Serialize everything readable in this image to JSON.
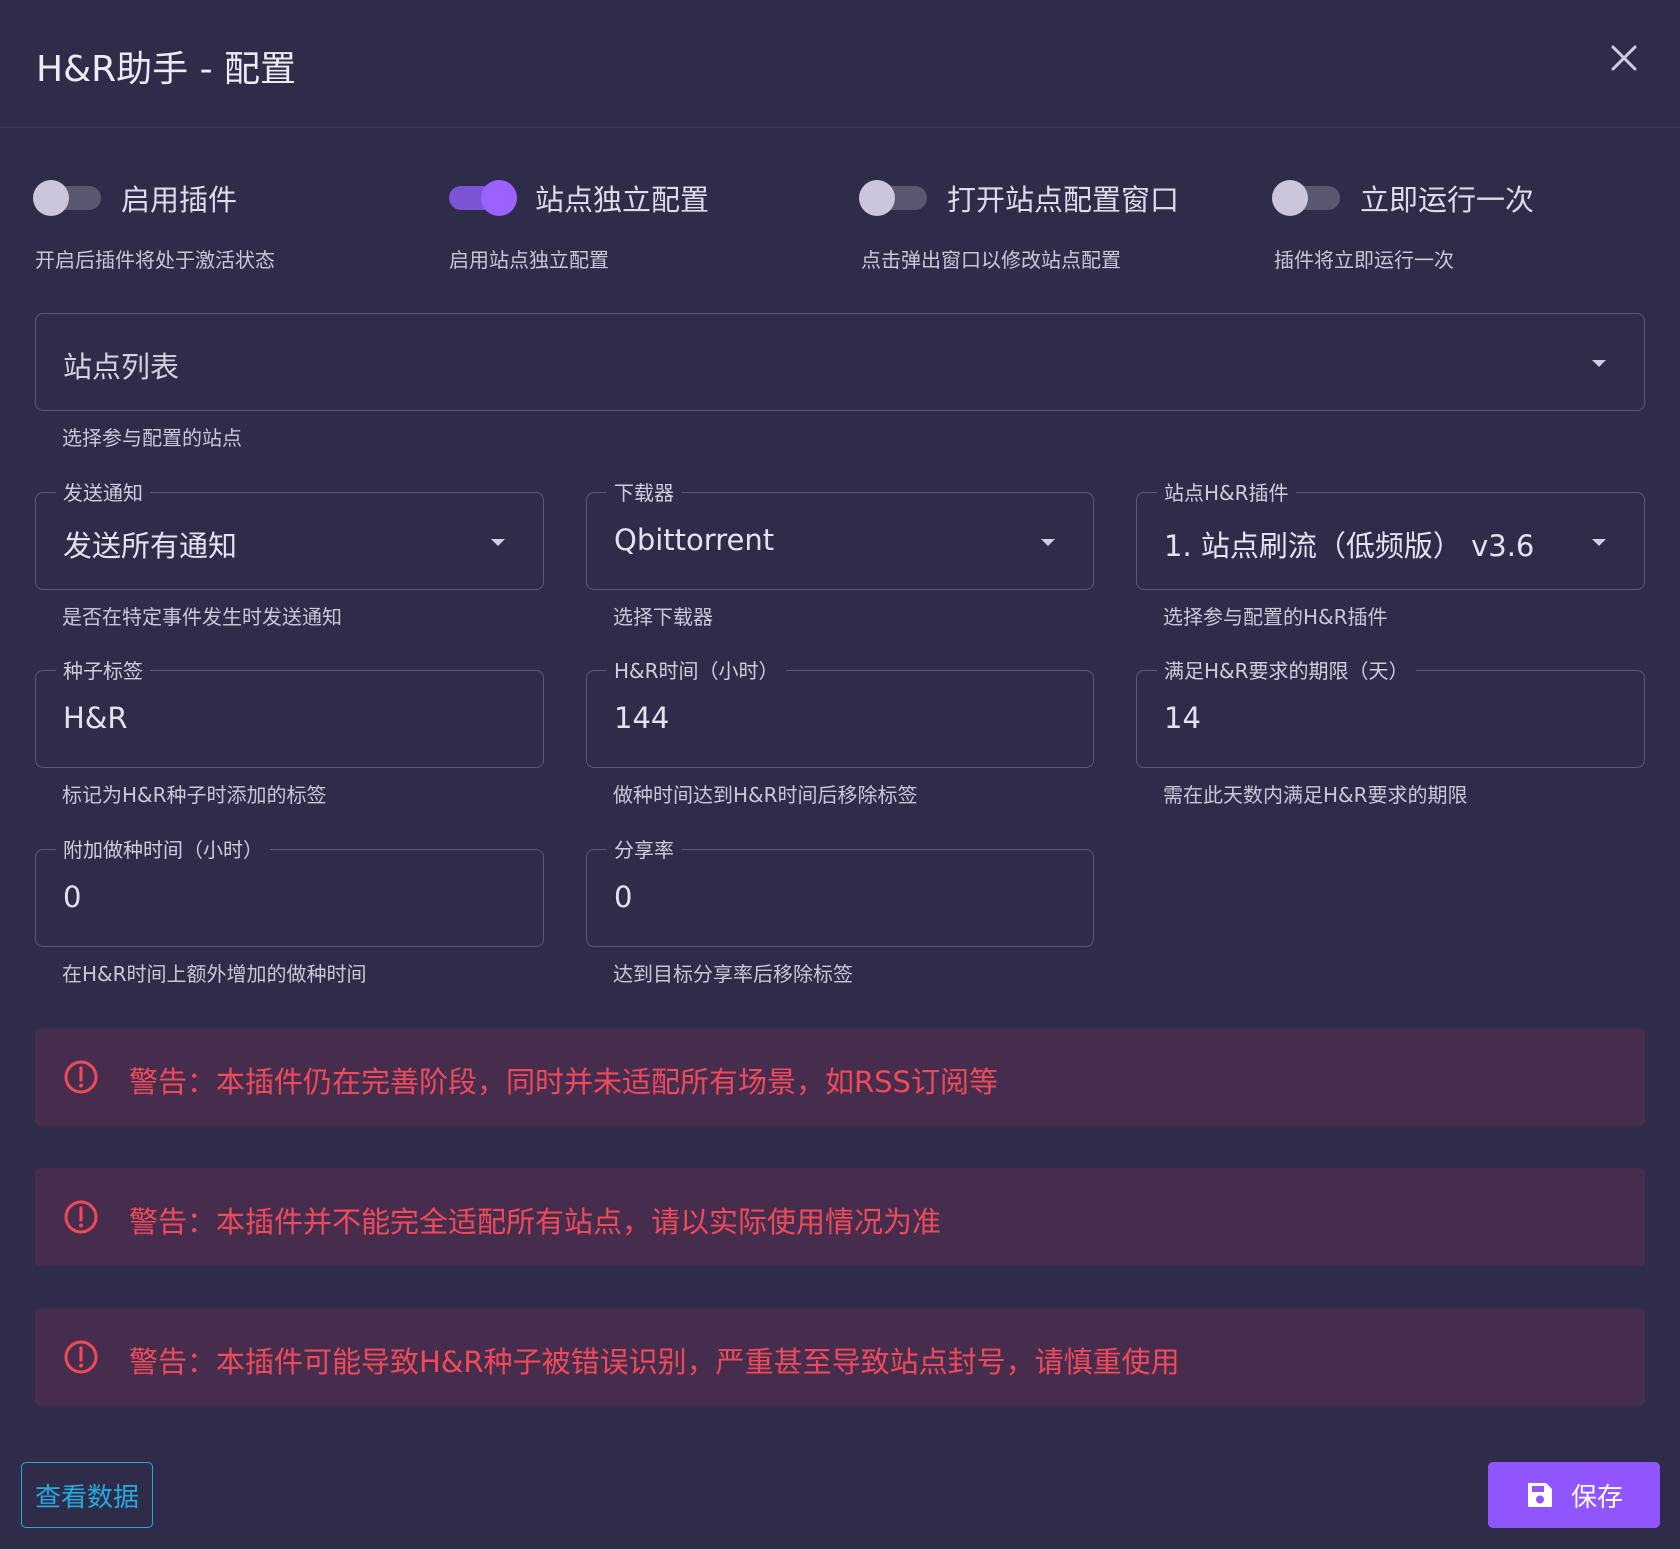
{
  "header": {
    "title": "H&R助手 - 配置",
    "close_icon": "close-icon"
  },
  "switches": [
    {
      "label": "启用插件",
      "hint": "开启后插件将处于激活状态",
      "checked": false
    },
    {
      "label": "站点独立配置",
      "hint": "启用站点独立配置",
      "checked": true
    },
    {
      "label": "打开站点配置窗口",
      "hint": "点击弹出窗口以修改站点配置",
      "checked": false
    },
    {
      "label": "立即运行一次",
      "hint": "插件将立即运行一次",
      "checked": false
    }
  ],
  "site_list": {
    "placeholder": "站点列表",
    "hint": "选择参与配置的站点"
  },
  "notify": {
    "legend": "发送通知",
    "value": "发送所有通知",
    "hint": "是否在特定事件发生时发送通知"
  },
  "downloader": {
    "legend": "下载器",
    "value": "Qbittorrent",
    "hint": "选择下载器"
  },
  "hr_plugin": {
    "legend": "站点H&R插件",
    "value": "1. 站点刷流（低频版） v3.6",
    "hint": "选择参与配置的H&R插件"
  },
  "torrent_tag": {
    "legend": "种子标签",
    "value": "H&R",
    "hint": "标记为H&R种子时添加的标签"
  },
  "hr_time": {
    "legend": "H&R时间（小时）",
    "value": "144",
    "hint": "做种时间达到H&R时间后移除标签"
  },
  "hr_deadline": {
    "legend": "满足H&R要求的期限（天）",
    "value": "14",
    "hint": "需在此天数内满足H&R要求的期限"
  },
  "extra_seed": {
    "legend": "附加做种时间（小时）",
    "value": "0",
    "hint": "在H&R时间上额外增加的做种时间"
  },
  "ratio": {
    "legend": "分享率",
    "value": "0",
    "hint": "达到目标分享率后移除标签"
  },
  "alerts": [
    {
      "text": "警告：本插件仍在完善阶段，同时并未适配所有场景，如RSS订阅等",
      "icon": "alert-circle-icon"
    },
    {
      "text": "警告：本插件并不能完全适配所有站点，请以实际使用情况为准",
      "icon": "alert-circle-icon"
    },
    {
      "text": "警告：本插件可能导致H&R种子被错误识别，严重甚至导致站点封号，请慎重使用",
      "icon": "alert-circle-icon"
    }
  ],
  "footer": {
    "view_label": "查看数据",
    "save_label": "保存",
    "save_icon": "floppy-disk-icon"
  },
  "colors": {
    "background": "#2f2c4a",
    "accent": "#9155fd",
    "warning_text": "#ef4a5a",
    "warning_bg": "#472d4d",
    "link": "#27a9e0"
  }
}
